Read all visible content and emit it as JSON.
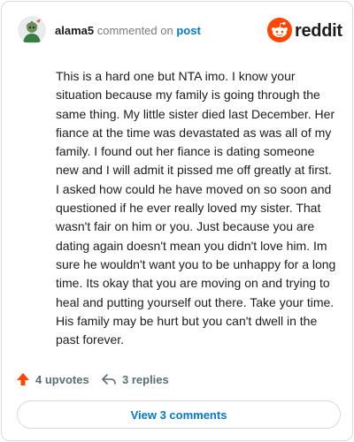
{
  "header": {
    "username": "alama5",
    "verb": "commented on",
    "post_link": "post",
    "brand": "reddit"
  },
  "comment": {
    "body": "This is a hard one but NTA imo. I know your situation because my family is going through the same thing. My little sister died last December. Her fiance at the time was devastated as was all of my family. I found out her fiance is dating someone new and I will admit it pissed me off greatly at first. I asked how could he have moved on so soon and questioned if he ever really loved my sister. That wasn't fair on him or you. Just because you are dating again doesn't mean you didn't love him. Im sure he wouldn't want you to be unhappy for a long time. Its okay that you are moving on and trying to heal and putting yourself out there. Take your time. His family may be hurt but you can't dwell in the past forever."
  },
  "actions": {
    "upvotes": "4 upvotes",
    "replies": "3 replies",
    "view_comments": "View 3 comments"
  },
  "colors": {
    "reddit_orange": "#ff4500",
    "upvote_orange": "#ff4500",
    "link_blue": "#0079d3",
    "muted_gray": "#576f76"
  }
}
